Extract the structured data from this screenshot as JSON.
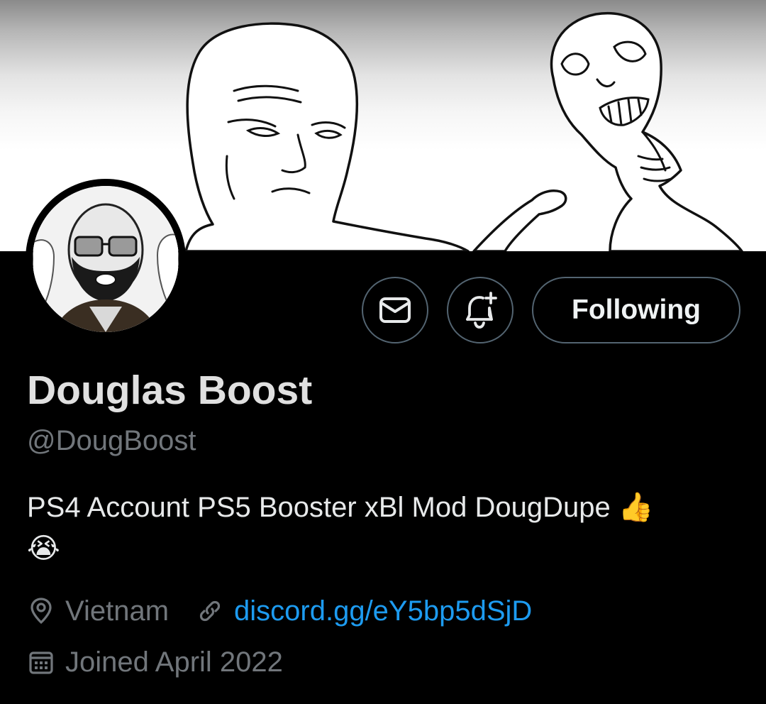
{
  "profile": {
    "name": "Douglas Boost",
    "handle": "@DougBoost",
    "bio": "PS4 Account PS5 Booster xBl Mod DougDupe",
    "bio_emojis": [
      "👍",
      "😭"
    ],
    "location": "Vietnam",
    "website": "discord.gg/eY5bp5dSjD",
    "joined": "Joined April 2022"
  },
  "actions": {
    "message_icon": "envelope-icon",
    "notify_icon": "bell-plus-icon",
    "follow_label": "Following"
  },
  "colors": {
    "background": "#000000",
    "text_primary": "#e7e9ea",
    "text_secondary": "#71767b",
    "link": "#1d9bf0",
    "button_border": "#536471"
  }
}
